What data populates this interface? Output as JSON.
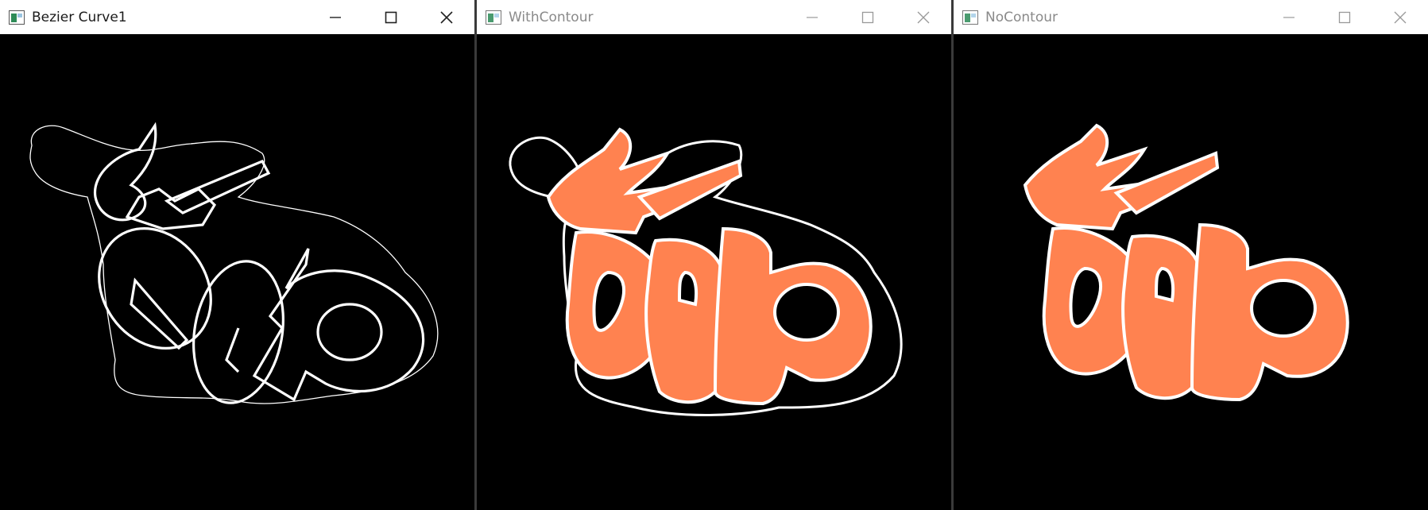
{
  "windows": [
    {
      "title": "Bezier Curve1",
      "active": true
    },
    {
      "title": "WithContour",
      "active": false
    },
    {
      "title": "NoContour",
      "active": false
    }
  ],
  "colors": {
    "fill": "#ff8250",
    "stroke": "#ffffff",
    "canvas": "#000000"
  },
  "icons": [
    "app-window-icon",
    "minimize-icon",
    "maximize-icon",
    "close-icon"
  ]
}
